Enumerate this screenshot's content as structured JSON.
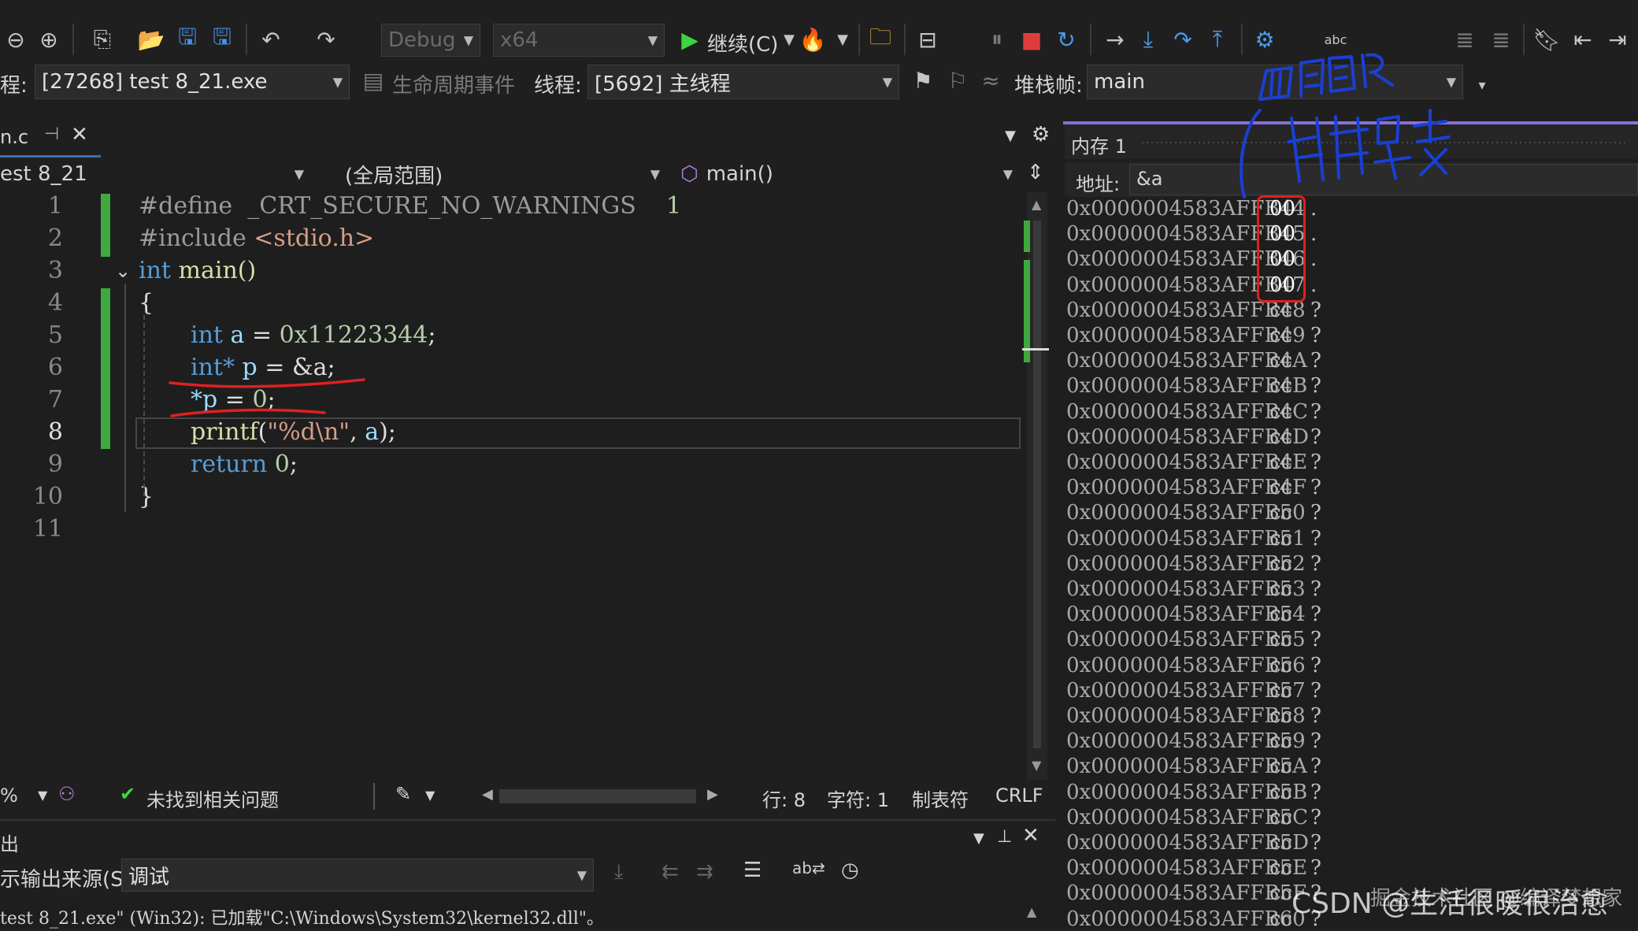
{
  "toolbar": {
    "config": "Debug",
    "platform": "x64",
    "continue_label": "继续(C)",
    "process_label": "程:",
    "process_value": "[27268] test 8_21.exe",
    "lifecycle_label": "生命周期事件",
    "thread_label": "线程:",
    "thread_value": "[5692] 主线程",
    "stackframe_label": "堆栈帧:",
    "stackframe_value": "main"
  },
  "editor": {
    "tab_name": "n.c",
    "nav_project": "est 8_21",
    "nav_scope": "(全局范围)",
    "nav_function": "main()",
    "lines": [
      {
        "num": "1"
      },
      {
        "num": "2"
      },
      {
        "num": "3"
      },
      {
        "num": "4"
      },
      {
        "num": "5"
      },
      {
        "num": "6"
      },
      {
        "num": "7"
      },
      {
        "num": "8"
      },
      {
        "num": "9"
      },
      {
        "num": "10"
      },
      {
        "num": "11"
      }
    ],
    "code": {
      "l1a": "#define",
      "l1b": "_CRT_SECURE_NO_WARNINGS",
      "l1c": "1",
      "l2a": "#include",
      "l2b": "<stdio.h>",
      "l3a": "int",
      "l3b": "main()",
      "l4": "{",
      "l5a": "int",
      "l5b": "a",
      "l5c": "=",
      "l5d": "0x11223344",
      "l5e": ";",
      "l6a": "int*",
      "l6b": "p",
      "l6c": "= &a;",
      "l7a": "*p",
      "l7b": "=",
      "l7c": "0",
      "l7d": ";",
      "l8a": "printf",
      "l8b": "(",
      "l8c": "\"%d\\n\"",
      "l8d": ",",
      "l8e": "a",
      "l8f": ");",
      "l9a": "return",
      "l9b": "0",
      "l9c": ";",
      "l10": "}"
    }
  },
  "status": {
    "zoom": "%",
    "issues": "未找到相关问题",
    "line": "行: 8",
    "char": "字符: 1",
    "tabs": "制表符",
    "eol": "CRLF"
  },
  "output": {
    "source_label": "示输出来源(S):",
    "source_value": "调试",
    "line1": "test 8_21.exe\" (Win32): 已加载\"C:\\Windows\\System32\\kernel32.dll\"。"
  },
  "memory": {
    "title": "内存 1",
    "address_label": "地址:",
    "address_value": "&a",
    "rows": [
      {
        "addr": "0x0000004583AFFB44",
        "val": "00",
        "ch": "."
      },
      {
        "addr": "0x0000004583AFFB45",
        "val": "00",
        "ch": "."
      },
      {
        "addr": "0x0000004583AFFB46",
        "val": "00",
        "ch": "."
      },
      {
        "addr": "0x0000004583AFFB47",
        "val": "00",
        "ch": "."
      },
      {
        "addr": "0x0000004583AFFB48",
        "val": "cc",
        "ch": "?"
      },
      {
        "addr": "0x0000004583AFFB49",
        "val": "cc",
        "ch": "?"
      },
      {
        "addr": "0x0000004583AFFB4A",
        "val": "cc",
        "ch": "?"
      },
      {
        "addr": "0x0000004583AFFB4B",
        "val": "cc",
        "ch": "?"
      },
      {
        "addr": "0x0000004583AFFB4C",
        "val": "cc",
        "ch": "?"
      },
      {
        "addr": "0x0000004583AFFB4D",
        "val": "cc",
        "ch": "?"
      },
      {
        "addr": "0x0000004583AFFB4E",
        "val": "cc",
        "ch": "?"
      },
      {
        "addr": "0x0000004583AFFB4F",
        "val": "cc",
        "ch": "?"
      },
      {
        "addr": "0x0000004583AFFB50",
        "val": "cc",
        "ch": "?"
      },
      {
        "addr": "0x0000004583AFFB51",
        "val": "cc",
        "ch": "?"
      },
      {
        "addr": "0x0000004583AFFB52",
        "val": "cc",
        "ch": "?"
      },
      {
        "addr": "0x0000004583AFFB53",
        "val": "cc",
        "ch": "?"
      },
      {
        "addr": "0x0000004583AFFB54",
        "val": "cc",
        "ch": "?"
      },
      {
        "addr": "0x0000004583AFFB55",
        "val": "cc",
        "ch": "?"
      },
      {
        "addr": "0x0000004583AFFB56",
        "val": "cc",
        "ch": "?"
      },
      {
        "addr": "0x0000004583AFFB57",
        "val": "cc",
        "ch": "?"
      },
      {
        "addr": "0x0000004583AFFB58",
        "val": "cc",
        "ch": "?"
      },
      {
        "addr": "0x0000004583AFFB59",
        "val": "cc",
        "ch": "?"
      },
      {
        "addr": "0x0000004583AFFB5A",
        "val": "cc",
        "ch": "?"
      },
      {
        "addr": "0x0000004583AFFB5B",
        "val": "cc",
        "ch": "?"
      },
      {
        "addr": "0x0000004583AFFB5C",
        "val": "cc",
        "ch": "?"
      },
      {
        "addr": "0x0000004583AFFB5D",
        "val": "cc",
        "ch": "?"
      },
      {
        "addr": "0x0000004583AFFB5E",
        "val": "cc",
        "ch": "?"
      },
      {
        "addr": "0x0000004583AFFB5F",
        "val": "cc",
        "ch": "?"
      },
      {
        "addr": "0x0000004583AFFB60",
        "val": "cc",
        "ch": "?"
      }
    ]
  },
  "watermark": "CSDN @生活很暖很治愈",
  "watermark2": "掘金技术社区 @编译梦想家",
  "colors": {
    "accent": "#3fa93f",
    "stop": "#e03c3c",
    "run": "#3fd43f",
    "annotation": "#1a3fd6",
    "highlight_box": "#e02020"
  }
}
